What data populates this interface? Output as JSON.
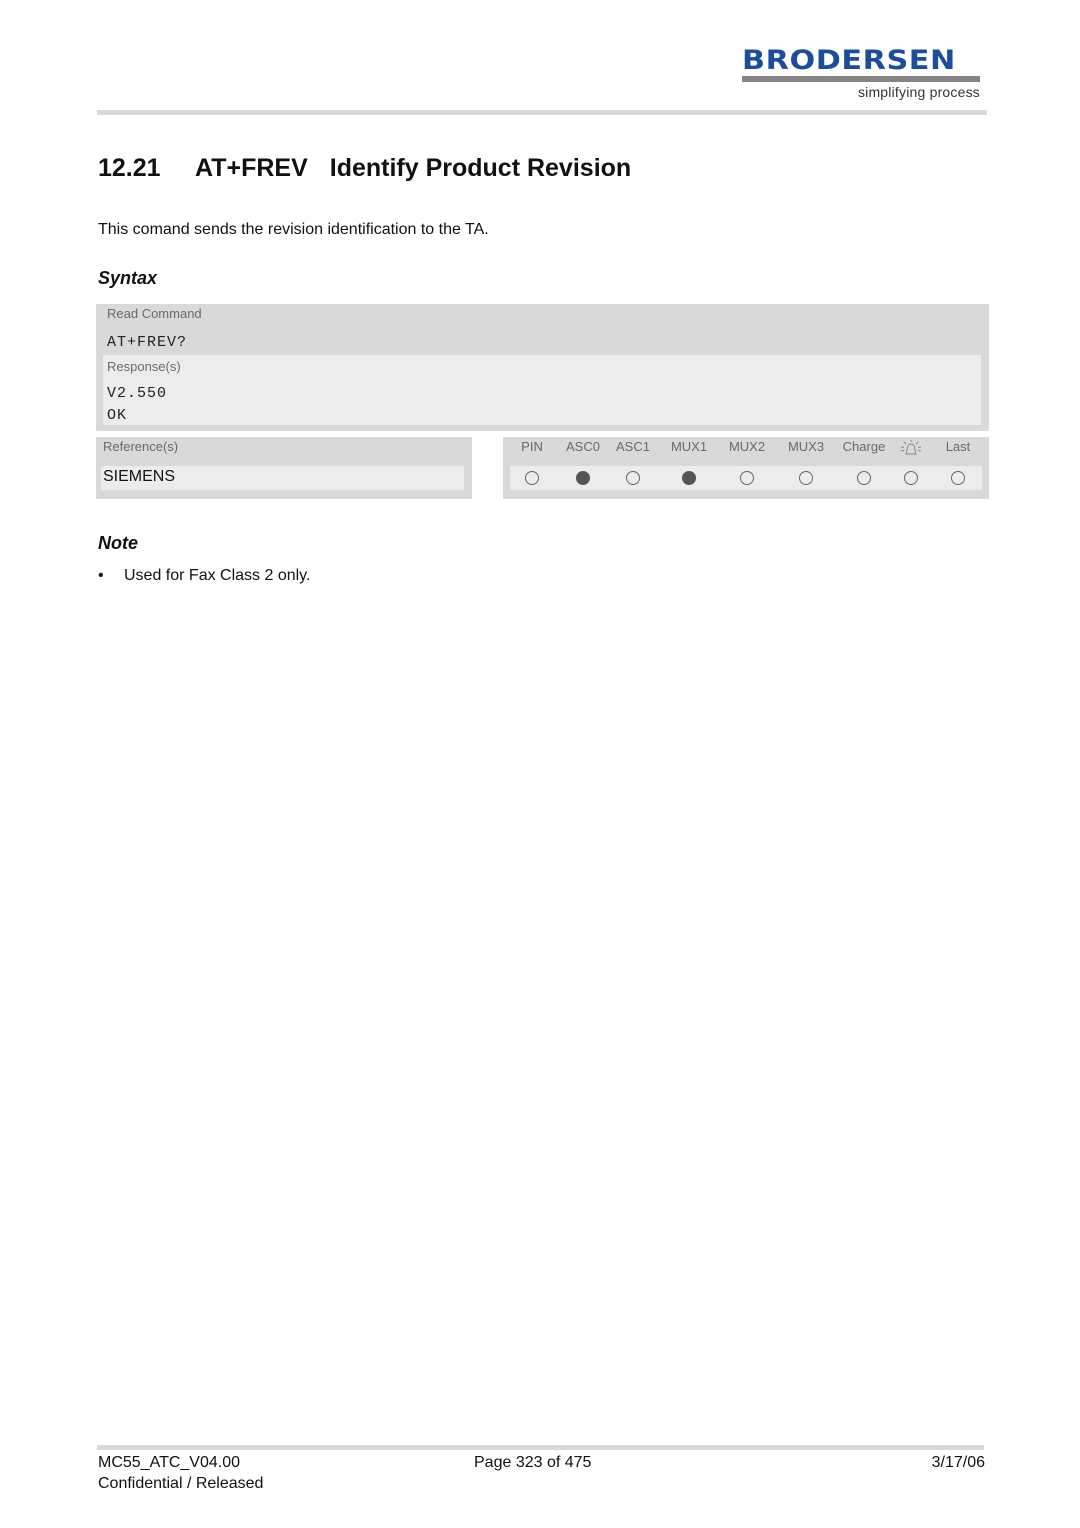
{
  "header": {
    "logo_name": "BRODERSEN",
    "logo_tagline": "simplifying process",
    "brand_color": "#1c4c9a"
  },
  "section": {
    "number": "12.21",
    "command": "AT+FREV",
    "title": "Identify Product Revision",
    "intro": "This comand sends the revision identification to the TA."
  },
  "syntax": {
    "heading": "Syntax",
    "read_command_label": "Read Command",
    "read_command": "AT+FREV?",
    "responses_label": "Response(s)",
    "responses": [
      "V2.550",
      "OK"
    ]
  },
  "reference": {
    "label": "Reference(s)",
    "value": "SIEMENS"
  },
  "status_table": {
    "columns": [
      {
        "label": "PIN",
        "icon": null,
        "active": false
      },
      {
        "label": "ASC0",
        "icon": null,
        "active": true
      },
      {
        "label": "ASC1",
        "icon": null,
        "active": false
      },
      {
        "label": "MUX1",
        "icon": null,
        "active": true
      },
      {
        "label": "MUX2",
        "icon": null,
        "active": false
      },
      {
        "label": "MUX3",
        "icon": null,
        "active": false
      },
      {
        "label": "Charge",
        "icon": null,
        "active": false
      },
      {
        "label": "",
        "icon": "alarm-bell-icon",
        "active": false
      },
      {
        "label": "Last",
        "icon": null,
        "active": false
      }
    ]
  },
  "note": {
    "heading": "Note",
    "bullet": "•",
    "items": [
      "Used for Fax Class 2 only."
    ]
  },
  "footer": {
    "doc_id": "MC55_ATC_V04.00",
    "page": "Page 323 of 475",
    "date": "3/17/06",
    "classification": "Confidential / Released"
  }
}
